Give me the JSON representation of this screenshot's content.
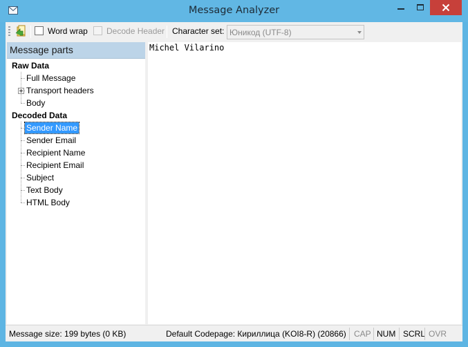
{
  "window": {
    "title": "Message Analyzer"
  },
  "toolbar": {
    "word_wrap_label": "Word wrap",
    "word_wrap_checked": false,
    "decode_header_label": "Decode Header",
    "decode_header_checked": false,
    "charset_label": "Character set:",
    "charset_value": "Юникод (UTF-8)"
  },
  "tree": {
    "header": "Message parts",
    "groups": [
      {
        "label": "Raw Data",
        "items": [
          "Full Message",
          "Transport headers",
          "Body"
        ]
      },
      {
        "label": "Decoded Data",
        "items": [
          "Sender Name",
          "Sender Email",
          "Recipient Name",
          "Recipient Email",
          "Subject",
          "Text Body",
          "HTML Body"
        ]
      }
    ],
    "selected": "Sender Name"
  },
  "content": {
    "text": "Michel Vilarino"
  },
  "status": {
    "size": "Message size: 199 bytes (0 KB)",
    "codepage": "Default Codepage: Кириллица (KOI8-R) (20866)",
    "indicators": {
      "cap": "CAP",
      "num": "NUM",
      "scrl": "SCRL",
      "ovr": "OVR"
    }
  },
  "colors": {
    "title_bar": "#61b7e4",
    "close_button": "#c7403a",
    "selection": "#3399ff",
    "panel_header": "#bcd4e8"
  }
}
